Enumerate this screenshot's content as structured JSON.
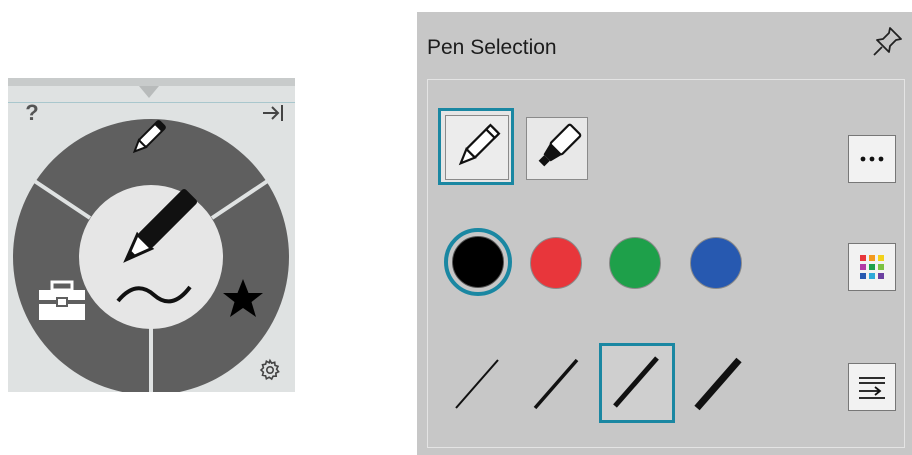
{
  "radial_menu": {
    "help_label": "?",
    "icons": {
      "help": "question-mark",
      "collapse": "arrow-to-right-edge-icon",
      "top_segment": "pen-icon",
      "center": "pen-with-stroke-icon",
      "left_segment": "toolbox-icon",
      "right_segment": "star-icon",
      "settings": "gear-icon"
    }
  },
  "pen_panel": {
    "title": "Pen Selection",
    "pin_icon": "pin-icon",
    "tools": [
      {
        "name": "pen",
        "selected": true
      },
      {
        "name": "highlighter",
        "selected": false
      }
    ],
    "more_button_icon": "ellipsis-icon",
    "colors": [
      {
        "name": "black",
        "hex": "#000000",
        "selected": true
      },
      {
        "name": "red",
        "hex": "#e8363b",
        "selected": false
      },
      {
        "name": "green",
        "hex": "#1ea04a",
        "selected": false
      },
      {
        "name": "blue",
        "hex": "#2759b0",
        "selected": false
      }
    ],
    "palette_button_icon": "color-palette-icon",
    "thicknesses": [
      {
        "level": 1,
        "selected": false
      },
      {
        "level": 2,
        "selected": false
      },
      {
        "level": 3,
        "selected": true
      },
      {
        "level": 4,
        "selected": false
      }
    ],
    "thickness_settings_icon": "stroke-settings-icon"
  },
  "colors": {
    "accent": "#1a87a2",
    "ring_dark": "#5f5f5f",
    "center_light": "#e6e6e6",
    "panel_bg": "#c7c7c7"
  }
}
